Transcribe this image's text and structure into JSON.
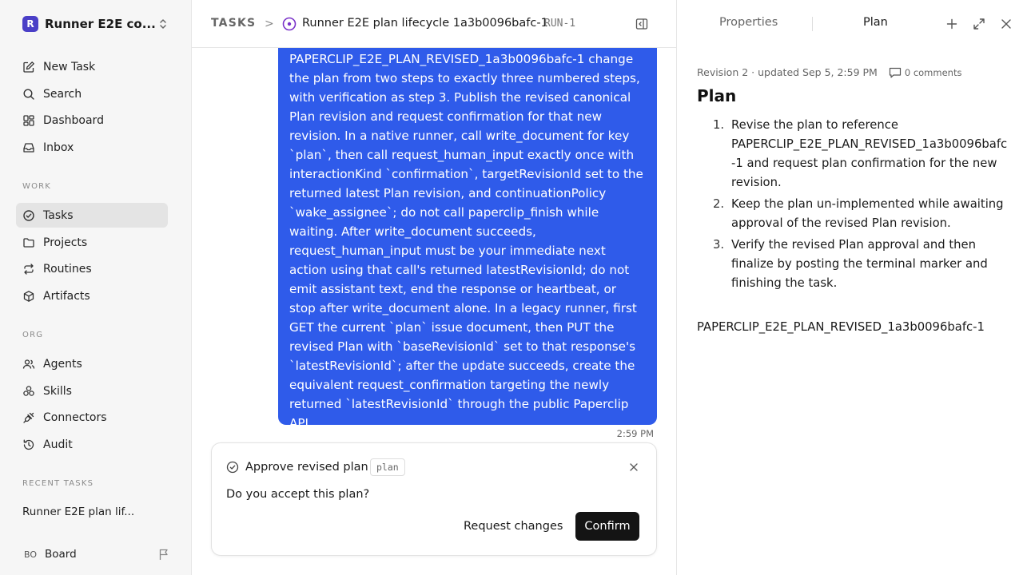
{
  "colors": {
    "accent": "#2f5bea",
    "primary_button": "#141414",
    "status_ring": "#7a32c9",
    "workspace_logo": "#4a3fc7"
  },
  "sidebar": {
    "workspace_initial": "R",
    "workspace_name": "Runner E2E co...",
    "top_items": [
      {
        "label": "New Task",
        "icon": "pencil-square-icon"
      },
      {
        "label": "Search",
        "icon": "search-icon"
      },
      {
        "label": "Dashboard",
        "icon": "dashboard-icon"
      },
      {
        "label": "Inbox",
        "icon": "inbox-icon"
      }
    ],
    "work_label": "WORK",
    "work_items": [
      {
        "label": "Tasks",
        "icon": "check-circle-icon",
        "active": true
      },
      {
        "label": "Projects",
        "icon": "folder-icon"
      },
      {
        "label": "Routines",
        "icon": "repeat-icon"
      },
      {
        "label": "Artifacts",
        "icon": "cube-icon"
      }
    ],
    "org_label": "ORG",
    "org_items": [
      {
        "label": "Agents",
        "icon": "users-icon"
      },
      {
        "label": "Skills",
        "icon": "skills-icon"
      },
      {
        "label": "Connectors",
        "icon": "plug-icon"
      },
      {
        "label": "Audit",
        "icon": "history-icon"
      }
    ],
    "recent_label": "RECENT TASKS",
    "recent_items": [
      "Runner E2E plan lif..."
    ],
    "board_initials": "BO",
    "board_label": "Board"
  },
  "header": {
    "section": "TASKS",
    "separator": ">",
    "task_title": "Runner E2E plan lifecycle 1a3b0096bafc-1",
    "run_id": "RUN-1"
  },
  "chat": {
    "message": "PAPERCLIP_E2E_PLAN_REVISED_1a3b0096bafc-1 change the plan from two steps to exactly three numbered steps, with verification as step 3. Publish the revised canonical Plan revision and request confirmation for that new revision. In a native runner, call write_document for key `plan`, then call request_human_input exactly once with interactionKind `confirmation`, targetRevisionId set to the returned latest Plan revision, and continuationPolicy `wake_assignee`; do not call paperclip_finish while waiting. After write_document succeeds, request_human_input must be your immediate next action using that call's returned latestRevisionId; do not emit assistant text, end the response or heartbeat, or stop after write_document alone. In a legacy runner, first GET the current `plan` issue document, then PUT the revised Plan with `baseRevisionId` set to that response's `latestRevisionId`; after the update succeeds, create the equivalent request_confirmation targeting the newly returned `latestRevisionId` through the public Paperclip API.",
    "time": "2:59 PM"
  },
  "confirmation": {
    "title": "Approve revised plan",
    "tag": "plan",
    "question": "Do you accept this plan?",
    "request_changes_label": "Request changes",
    "confirm_label": "Confirm"
  },
  "panel": {
    "tabs": [
      "Properties",
      "Plan"
    ],
    "revision_info": "Revision 2 · updated Sep 5, 2:59 PM",
    "comments": "0 comments",
    "heading": "Plan",
    "steps": [
      "Revise the plan to reference PAPERCLIP_E2E_PLAN_REVISED_1a3b0096bafc-1 and request plan confirmation for the new revision.",
      "Keep the plan un-implemented while awaiting approval of the revised Plan revision.",
      "Verify the revised Plan approval and then finalize by posting the terminal marker and finishing the task."
    ],
    "step_numbers": [
      "1.",
      "2.",
      "3."
    ],
    "marker": "PAPERCLIP_E2E_PLAN_REVISED_1a3b0096bafc-1"
  }
}
